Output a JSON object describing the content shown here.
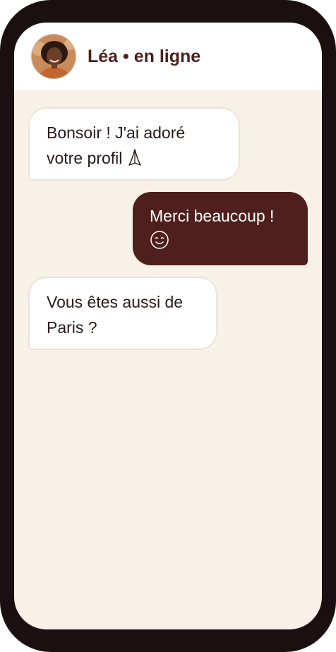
{
  "header": {
    "title": "Léa • en ligne"
  },
  "messages": [
    {
      "direction": "received",
      "text": "Bonsoir ! J'ai adoré votre profil",
      "icon": "folded-hands-icon"
    },
    {
      "direction": "sent",
      "text": "Merci beaucoup !",
      "icon": "smiling-face-icon"
    },
    {
      "direction": "received",
      "text": "Vous êtes aussi de Paris ?"
    }
  ],
  "colors": {
    "frame": "#1b1011",
    "chat_background": "#f8f1e8",
    "accent": "#4e1f1c",
    "received_bubble": "#ffffff",
    "received_border": "#ece3d5"
  }
}
